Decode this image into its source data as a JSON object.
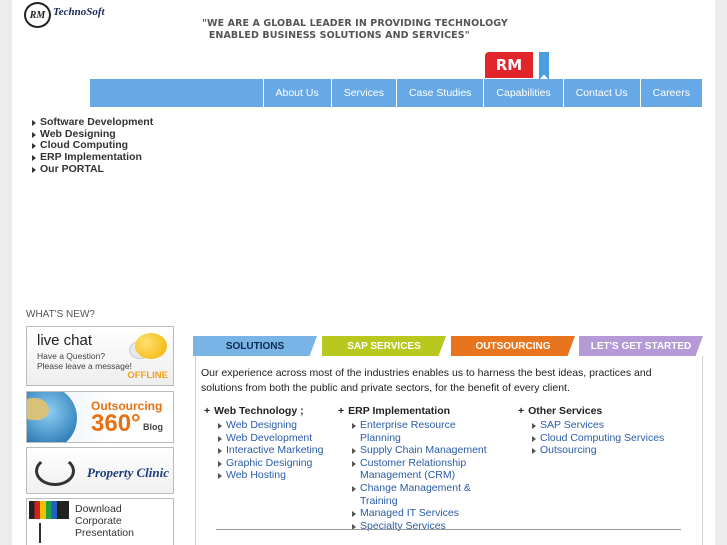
{
  "logo": {
    "badge": "RM",
    "name": "TechnoSoft"
  },
  "tagline": "\"WE ARE A GLOBAL LEADER IN PROVIDING TECHNOLOGY\n  ENABLED BUSINESS SOLUTIONS AND SERVICES\"",
  "rm_tab": "RM",
  "nav": [
    "About Us",
    "Services",
    "Case Studies",
    "Capabilities",
    "Contact Us",
    "Careers"
  ],
  "side_menu": [
    "Software Development",
    "Web Designing",
    "Cloud Computing",
    "ERP Implementation",
    "Our PORTAL"
  ],
  "whats_new": "WHAT'S NEW?",
  "promos": {
    "chat": {
      "title": "live chat",
      "subtitle": "Have a Question?\nPlease leave a message!",
      "status": "OFFLINE"
    },
    "outsourcing": {
      "title": "Outsourcing",
      "number": "360°",
      "suffix": "Blog"
    },
    "property": {
      "title": "Property Clinic"
    },
    "download": {
      "text": "Download\nCorporate\nPresentation"
    }
  },
  "tabs": [
    {
      "label": "SOLUTIONS",
      "color": "#7ab4e6",
      "text_color": "#0d2a52"
    },
    {
      "label": "SAP SERVICES",
      "color": "#b8c81e",
      "text_color": "#ffffff"
    },
    {
      "label": "OUTSOURCING",
      "color": "#e8741e",
      "text_color": "#ffffff"
    },
    {
      "label": "LET'S GET STARTED",
      "color": "#b49ad6",
      "text_color": "#ffffff"
    }
  ],
  "intro": "Our experience across most of the industries enables us to harness the best ideas, practices and solutions from both the public and private sectors, for the benefit of every client.",
  "columns": [
    {
      "title": "Web Technology ;",
      "items": [
        "Web Designing",
        "Web Development",
        "Interactive Marketing",
        "Graphic Designing",
        "Web Hosting"
      ]
    },
    {
      "title": "ERP Implementation",
      "items": [
        "Enterprise Resource Planning",
        "Supply Chain Management",
        "Customer Relationship Management (CRM)",
        "Change Management & Training",
        "Managed IT Services",
        "Specialty Services"
      ]
    },
    {
      "title": "Other Services",
      "items": [
        "SAP Services",
        "Cloud Computing Services",
        "Outsourcing"
      ]
    }
  ]
}
